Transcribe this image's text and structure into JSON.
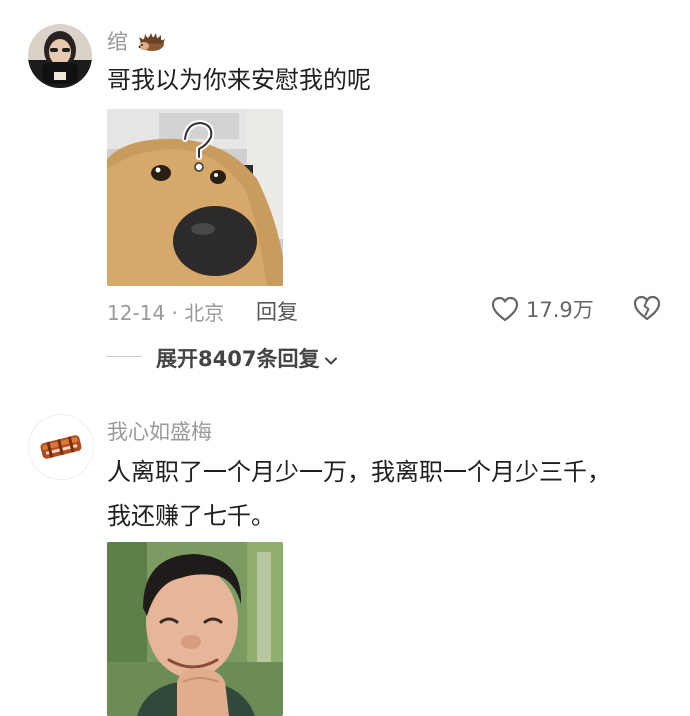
{
  "comments": [
    {
      "username": "绾",
      "username_icon": "hedgehog-icon",
      "text_lines": [
        "哥我以为你来安慰我的呢"
      ],
      "image": "dog-question-meme",
      "date_location": "12-14 · 北京",
      "reply_label": "回复",
      "like_count": "17.9万",
      "expand_replies_label": "展开8407条回复"
    },
    {
      "username": "我心如盛梅",
      "text_lines": [
        "人离职了一个月少一万，我离职一个月少三千，",
        "我还赚了七千。"
      ],
      "image": "laughing-man-photo"
    }
  ],
  "colors": {
    "username": "#9a9a9a",
    "text": "#1f1f1f",
    "meta": "#9a9a9a",
    "icon": "#666666"
  }
}
